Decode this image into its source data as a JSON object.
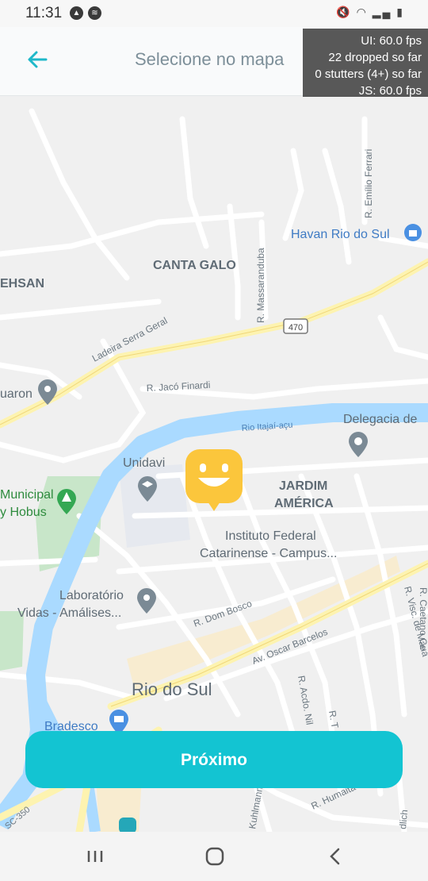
{
  "status_bar": {
    "time": "11:31",
    "left_icons": [
      "assistant-icon",
      "spotify-icon"
    ],
    "right_icons": [
      "mute-icon",
      "wifi-icon",
      "signal-icon",
      "battery-icon"
    ]
  },
  "header": {
    "title": "Selecione no mapa",
    "back_icon": "arrow-left-icon"
  },
  "fps_overlay": {
    "line1": "UI: 60.0 fps",
    "line2": "22 dropped so far",
    "line3": "0 stutters (4+) so far",
    "line4": "JS: 60.0 fps"
  },
  "map": {
    "labels": {
      "canta_galo": "CANTA GALO",
      "ehsan": "EHSAN",
      "havan": "Havan Rio do Sul",
      "massarandu": "R. Massarandubа",
      "emilio": "R. Emílio Ferrari",
      "ladeira": "Ladeira Serra Geral",
      "route_470": "470",
      "uaron": "uaron",
      "jaco": "R. Jacó Finardi",
      "rio": "Rio Itajaí-açu",
      "delegacia": "Delegacia de",
      "unidavi": "Unidavi",
      "municipal": "Municipal",
      "hobus": "y Hobus",
      "jardim": "JARDIM",
      "america": "AMÉRICA",
      "instituto1": "Instituto Federal",
      "instituto2": "Catarinense -  Campus...",
      "lab1": "Laboratório",
      "lab2": "Vidas - Amális​es...",
      "dom_bosco": "R. Dom Bosco",
      "oscar": "Av. Oscar Barcelos",
      "rio_do_sul": "Rio do Sul",
      "bradesco": "Bradesco",
      "caetano": "R. Caetano Ce",
      "visc": "R. Visc. de Mauá",
      "acdo": "R. Acdo. Nil",
      "humai": "R. Humaitá",
      "kuhlmann": "Kuhlmann",
      "sc350": "SC-350",
      "r_t": "R. T",
      "dlich": "dlich"
    }
  },
  "actions": {
    "next_label": "Próximo"
  },
  "nav_bar": {
    "recent_icon": "recent-apps-icon",
    "home_icon": "home-icon",
    "back_icon": "back-icon"
  },
  "colors": {
    "accent": "#13c4d2",
    "pin": "#fbc63c",
    "water": "#aadaff",
    "major_road": "#fdf3b0"
  }
}
